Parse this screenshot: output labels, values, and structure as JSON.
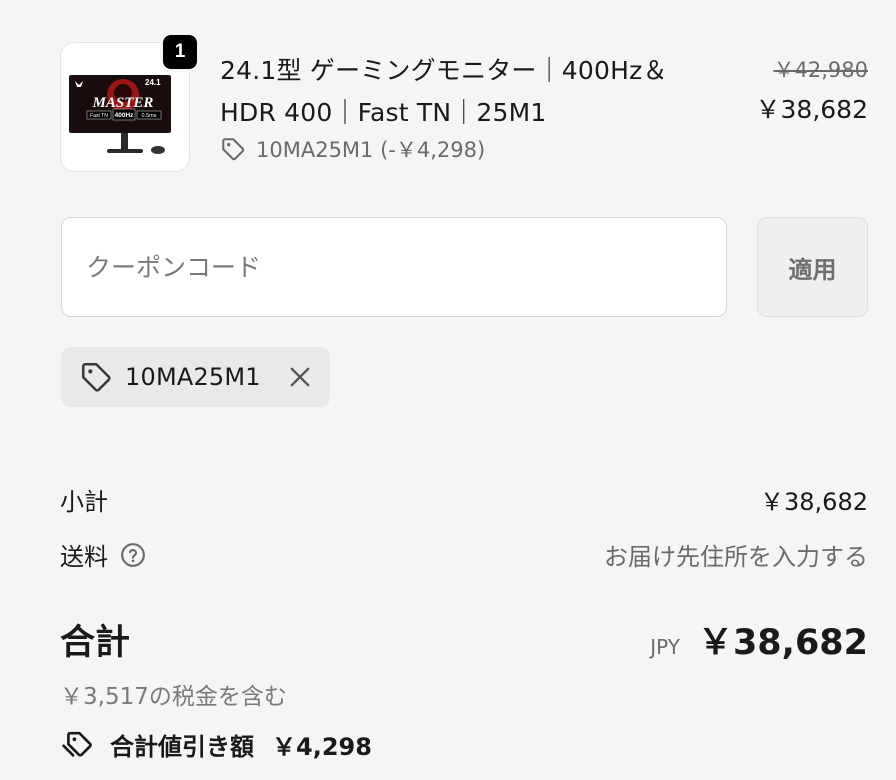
{
  "cart_item": {
    "quantity": "1",
    "title": "24.1型 ゲーミングモニター｜400Hz＆HDR 400｜Fast TN｜25M1",
    "discount_code_note": "10MA25M1 (-￥4,298)",
    "price_original": "￥42,980",
    "price_current": "￥38,682",
    "thumbnail": {
      "screen_size_label": "24.1",
      "brand_text": "MASTER",
      "spec_labels": [
        "Fast TN",
        "400Hz",
        "0.5ms"
      ]
    }
  },
  "coupon": {
    "placeholder": "クーポンコード",
    "value": "",
    "apply_label": "適用",
    "applied_code": "10MA25M1"
  },
  "summary": {
    "subtotal_label": "小計",
    "subtotal_value": "￥38,682",
    "shipping_label": "送料",
    "shipping_value": "お届け先住所を入力する",
    "total_label": "合計",
    "currency": "JPY",
    "total_value": "￥38,682",
    "tax_note": "￥3,517の税金を含む",
    "savings_label": "合計値引き額",
    "savings_value": "￥4,298"
  },
  "colors": {
    "background": "#f5f5f5",
    "text_primary": "#1a1a1a",
    "text_muted": "#6b6b6b",
    "badge": "#000000"
  },
  "icons": [
    "tag-icon",
    "close-icon",
    "question-circle-icon",
    "double-tag-icon"
  ]
}
